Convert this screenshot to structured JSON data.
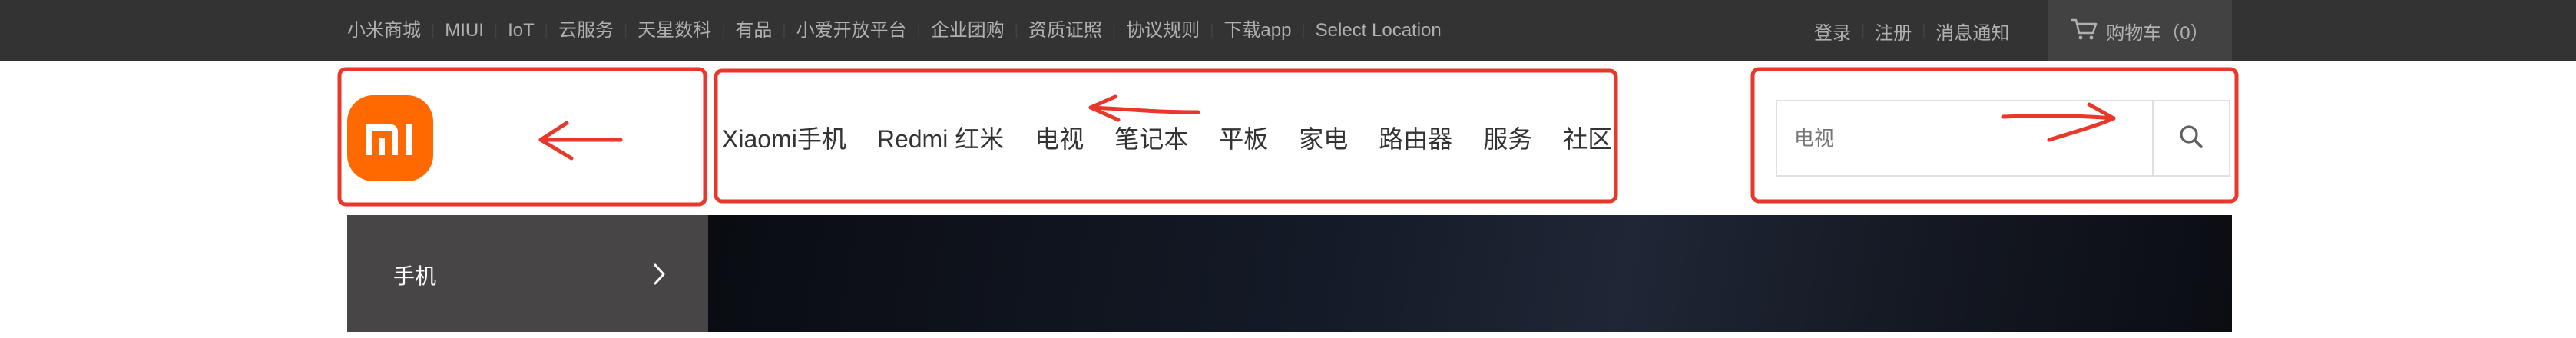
{
  "topbar": {
    "links": [
      "小米商城",
      "MIUI",
      "IoT",
      "云服务",
      "天星数科",
      "有品",
      "小爱开放平台",
      "企业团购",
      "资质证照",
      "协议规则",
      "下载app",
      "Select Location"
    ],
    "login": "登录",
    "register": "注册",
    "notifications": "消息通知",
    "cart_label": "购物车（0）"
  },
  "header": {
    "logo_text": "mi",
    "nav": [
      "Xiaomi手机",
      "Redmi 红米",
      "电视",
      "笔记本",
      "平板",
      "家电",
      "路由器",
      "服务",
      "社区"
    ],
    "search_placeholder": "电视"
  },
  "hero": {
    "categories": [
      "手机"
    ]
  },
  "colors": {
    "brand": "#ff6900",
    "topbar_bg": "#333333",
    "annotation": "#e8382a"
  }
}
